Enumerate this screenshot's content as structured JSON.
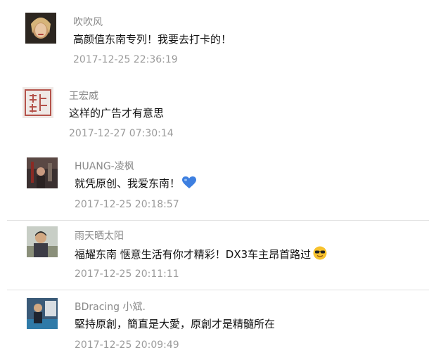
{
  "comments": [
    {
      "nickname": "吹吹风",
      "text": "高颜值东南专列！我要去打卡的！",
      "timestamp": "2017-12-25 22:36:19"
    },
    {
      "nickname": "王宏威",
      "text": "这样的广告才有意思",
      "timestamp": "2017-12-27 07:30:14"
    },
    {
      "nickname": "HUANG-凌枫",
      "text": "就凭原创、我爱东南！",
      "emoji": "blue-heart-emoji",
      "timestamp": "2017-12-25 20:18:57"
    },
    {
      "nickname": "雨天晒太阳",
      "text": "福耀东南 惬意生活有你才精彩！DX3车主昂首路过",
      "emoji": "sunglasses-emoji",
      "timestamp": "2017-12-25 20:11:11"
    },
    {
      "nickname": "BDracing 小斌.",
      "text": "堅持原創，簡直是大愛，原創才是精髓所在",
      "timestamp": "2017-12-25 20:09:49"
    }
  ],
  "colors": {
    "nickname": "#8a8a8a",
    "text": "#111111",
    "timestamp": "#9b9b9b",
    "divider": "#e2e2e2",
    "heart": "#3d7fe0",
    "smiley": "#f7c22e"
  }
}
